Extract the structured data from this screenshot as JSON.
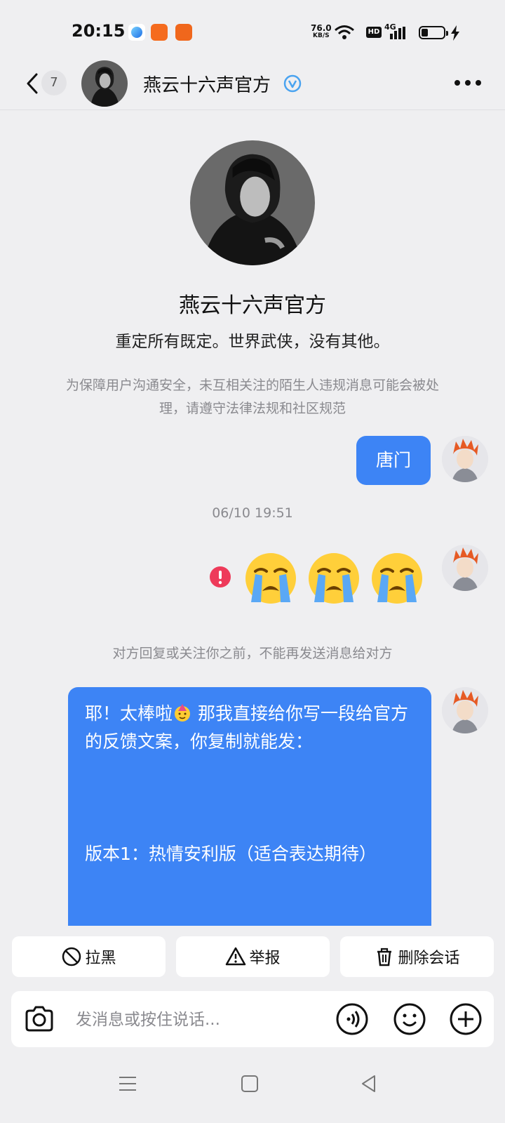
{
  "status_bar": {
    "time": "20:15",
    "net_speed_value": "76.0",
    "net_speed_unit": "KB/S",
    "hd_label": "HD",
    "network_label": "4G"
  },
  "header": {
    "unread_count": "7",
    "contact_name": "燕云十六声官方"
  },
  "profile": {
    "name": "燕云十六声官方",
    "bio": "重定所有既定。世界武侠，没有其他。",
    "safety_notice": "为保障用户沟通安全，未互相关注的陌生人违规消息可能会被处理，请遵守法律法规和社区规范"
  },
  "messages": {
    "msg1": "唐门",
    "timestamp": "06/10 19:51",
    "emoji_count": 3,
    "system_note": "对方回复或关注你之前，不能再发送消息给对方",
    "long_line1_a": "耶！太棒啦",
    "long_line1_b": " 那我直接给你写一段给官方的反馈文案，你复制就能发：",
    "long_version": "版本1：热情安利版（适合表达期待）"
  },
  "actions": {
    "block": "拉黑",
    "report": "举报",
    "delete": "删除会话"
  },
  "input": {
    "placeholder": "发消息或按住说话..."
  },
  "colors": {
    "accent_blue": "#3d84f5",
    "background": "#efeff1",
    "error_red": "#ee3a5a",
    "verified_blue": "#4aa3f0"
  }
}
